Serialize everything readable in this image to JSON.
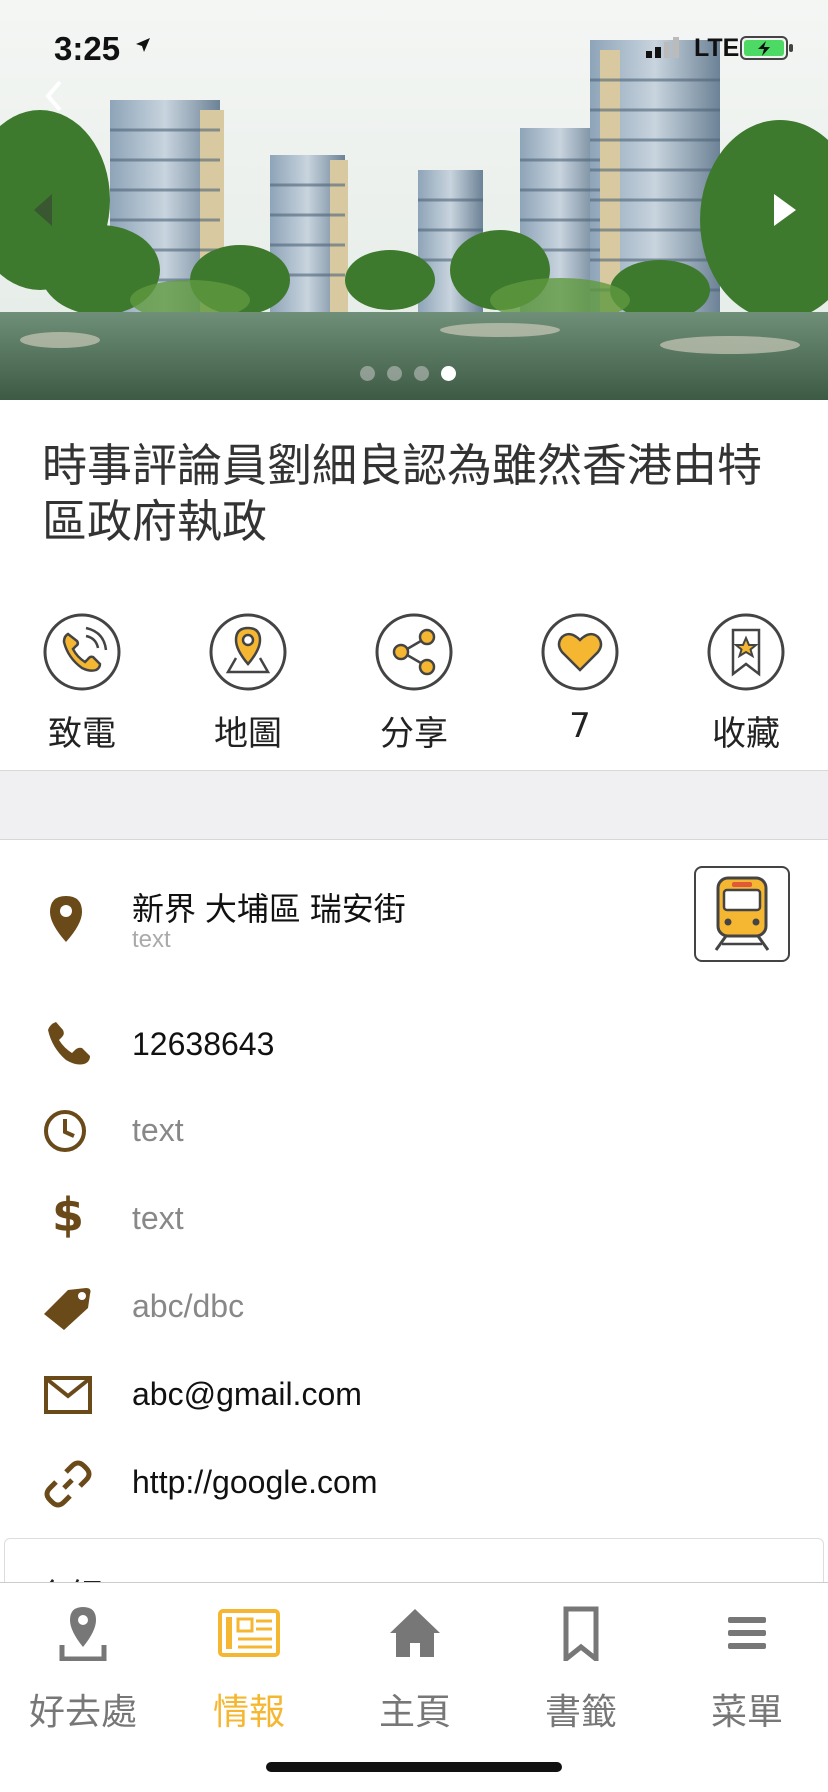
{
  "status": {
    "time": "3:25",
    "network": "LTE"
  },
  "hero": {
    "slides": 4,
    "active_slide": 4
  },
  "title": "時事評論員劉細良認為雖然香港由特區政府執政",
  "actions": [
    {
      "label": "致電",
      "icon": "phone-icon"
    },
    {
      "label": "地圖",
      "icon": "map-pin-icon"
    },
    {
      "label": "分享",
      "icon": "share-icon"
    },
    {
      "label": "7",
      "icon": "heart-icon"
    },
    {
      "label": "收藏",
      "icon": "bookmark-star-icon"
    }
  ],
  "info": {
    "address": "新界 大埔區 瑞安街",
    "address_sub": "text",
    "phone": "12638643",
    "hours": "text",
    "price": "text",
    "tags": "abc/dbc",
    "email": "abc@gmail.com",
    "website": "http://google.com"
  },
  "card": {
    "title": "介紹"
  },
  "tabs": [
    {
      "label": "好去處",
      "icon": "location-icon",
      "active": false
    },
    {
      "label": "情報",
      "icon": "newspaper-icon",
      "active": true
    },
    {
      "label": "主頁",
      "icon": "home-icon",
      "active": false
    },
    {
      "label": "書籤",
      "icon": "bookmark-icon",
      "active": false
    },
    {
      "label": "菜單",
      "icon": "menu-icon",
      "active": false
    }
  ],
  "colors": {
    "accent": "#f5b731",
    "icon_brown": "#6b4a1a",
    "grey": "#888888"
  }
}
